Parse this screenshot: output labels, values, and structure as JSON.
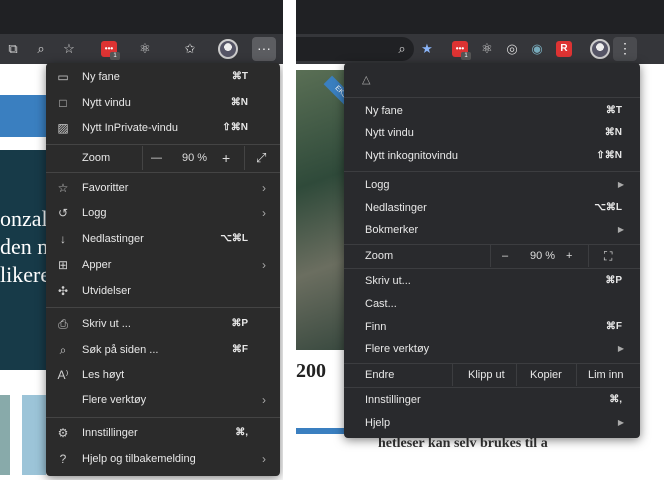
{
  "edge": {
    "items": [
      {
        "label": "Ny fane",
        "shortcut": "⌘T"
      },
      {
        "label": "Nytt vindu",
        "shortcut": "⌘N"
      },
      {
        "label": "Nytt InPrivate-vindu",
        "shortcut": "⇧⌘N"
      }
    ],
    "zoom": {
      "label": "Zoom",
      "minus": "—",
      "value": "90 %",
      "plus": "+"
    },
    "items2": [
      {
        "label": "Favoritter"
      },
      {
        "label": "Logg"
      },
      {
        "label": "Nedlastinger",
        "shortcut": "⌥⌘L"
      },
      {
        "label": "Apper"
      },
      {
        "label": "Utvidelser"
      }
    ],
    "items3": [
      {
        "label": "Skriv ut ...",
        "shortcut": "⌘P"
      },
      {
        "label": "Søk på siden ...",
        "shortcut": "⌘F"
      },
      {
        "label": "Les høyt"
      },
      {
        "label": "Flere verktøy"
      }
    ],
    "items4": [
      {
        "label": "Innstillinger",
        "shortcut": "⌘,"
      },
      {
        "label": "Hjelp og tilbakemelding"
      }
    ],
    "page_text": [
      "onzal",
      "den n",
      "likere"
    ],
    "ext_badge": "1",
    "more_glyph": "···"
  },
  "chrome": {
    "items": [
      {
        "label": "Ny fane",
        "shortcut": "⌘T"
      },
      {
        "label": "Nytt vindu",
        "shortcut": "⌘N"
      },
      {
        "label": "Nytt inkognitovindu",
        "shortcut": "⇧⌘N"
      }
    ],
    "items2": [
      {
        "label": "Logg"
      },
      {
        "label": "Nedlastinger",
        "shortcut": "⌥⌘L"
      },
      {
        "label": "Bokmerker"
      }
    ],
    "zoom": {
      "label": "Zoom",
      "minus": "–",
      "value": "90 %",
      "plus": "+"
    },
    "items3": [
      {
        "label": "Skriv ut...",
        "shortcut": "⌘P"
      },
      {
        "label": "Cast..."
      },
      {
        "label": "Finn",
        "shortcut": "⌘F"
      },
      {
        "label": "Flere verktøy"
      }
    ],
    "edit": {
      "label": "Endre",
      "cut": "Klipp ut",
      "copy": "Kopier",
      "paste": "Lim inn"
    },
    "items4": [
      {
        "label": "Innstillinger",
        "shortcut": "⌘,"
      },
      {
        "label": "Hjelp"
      }
    ],
    "page_number": "200",
    "page_snippet": "hetleser kan selv brukes til a",
    "ribbon": "EKST",
    "ext_badge": "1",
    "ext_r": "R",
    "more_glyph": "⋮"
  }
}
